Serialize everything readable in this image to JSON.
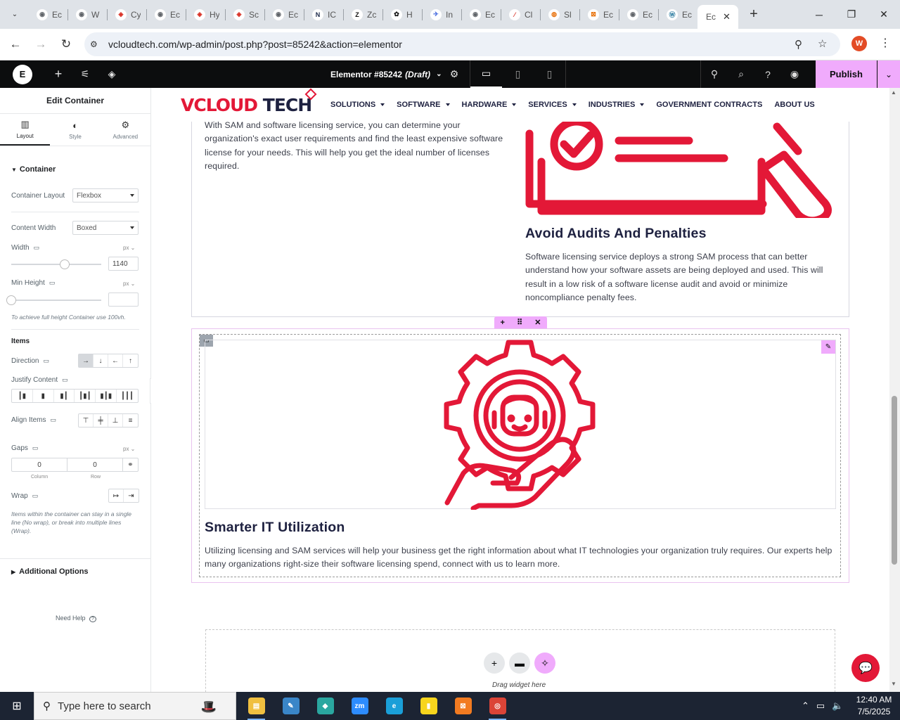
{
  "browser": {
    "tabs": [
      {
        "title": "Ec",
        "icon": "globe-icon",
        "color": "#5f6368",
        "glyph": "◉"
      },
      {
        "title": "W",
        "icon": "globe-icon",
        "color": "#5f6368",
        "glyph": "◉"
      },
      {
        "title": "Cy",
        "icon": "diamond-icon",
        "color": "#d93025",
        "glyph": "◈"
      },
      {
        "title": "Ec",
        "icon": "globe-icon",
        "color": "#5f6368",
        "glyph": "◉"
      },
      {
        "title": "Hy",
        "icon": "diamond-icon",
        "color": "#d93025",
        "glyph": "◈"
      },
      {
        "title": "Sc",
        "icon": "diamond-icon",
        "color": "#d93025",
        "glyph": "◈"
      },
      {
        "title": "Ec",
        "icon": "globe-icon",
        "color": "#5f6368",
        "glyph": "◉"
      },
      {
        "title": "IC",
        "icon": "ic-icon",
        "color": "#1b2a4a",
        "glyph": "N"
      },
      {
        "title": "Zc",
        "icon": "zapier-icon",
        "color": "#111111",
        "glyph": "Z"
      },
      {
        "title": "H",
        "icon": "openai-icon",
        "color": "#111111",
        "glyph": "✿"
      },
      {
        "title": "In",
        "icon": "bird-icon",
        "color": "#4a6ee0",
        "glyph": "✈"
      },
      {
        "title": "Ec",
        "icon": "globe-icon",
        "color": "#5f6368",
        "glyph": "◉"
      },
      {
        "title": "Cl",
        "icon": "claude-icon",
        "color": "#d93025",
        "glyph": "⁄"
      },
      {
        "title": "Sl",
        "icon": "colorwheel-icon",
        "color": "#e8710a",
        "glyph": "◍"
      },
      {
        "title": "Ec",
        "icon": "xampp-icon",
        "color": "#e8710a",
        "glyph": "⊠"
      },
      {
        "title": "Ec",
        "icon": "globe-icon",
        "color": "#5f6368",
        "glyph": "◉"
      },
      {
        "title": "Ec",
        "icon": "wordpress-icon",
        "color": "#21759b",
        "glyph": "Ⓦ"
      }
    ],
    "active_tab": {
      "title": "Ec",
      "close": "✕"
    },
    "new_tab": "+",
    "url": "vcloudtech.com/wp-admin/post.php?post=85242&action=elementor",
    "profile_initial": "W"
  },
  "elementor": {
    "doc_title": "Elementor #85242",
    "doc_status": "(Draft)",
    "publish_label": "Publish",
    "panel": {
      "title": "Edit Container",
      "tabs": [
        {
          "label": "Layout",
          "icon": "layout-icon"
        },
        {
          "label": "Style",
          "icon": "style-icon"
        },
        {
          "label": "Advanced",
          "icon": "gear-icon"
        }
      ],
      "section": "Container",
      "container_layout_label": "Container Layout",
      "container_layout_value": "Flexbox",
      "content_width_label": "Content Width",
      "content_width_value": "Boxed",
      "width_label": "Width",
      "width_unit": "px",
      "width_value": "1140",
      "width_slider_fraction": 0.59,
      "min_height_label": "Min Height",
      "min_height_unit": "px",
      "min_height_value": "",
      "min_height_hint": "To achieve full height Container use 100vh.",
      "items_label": "Items",
      "direction_label": "Direction",
      "justify_label": "Justify Content",
      "align_label": "Align Items",
      "gaps_label": "Gaps",
      "gaps_unit": "px",
      "gap_column": "0",
      "gap_row": "0",
      "gap_column_label": "Column",
      "gap_row_label": "Row",
      "wrap_label": "Wrap",
      "wrap_hint": "Items within the container can stay in a single line (No wrap), or break into multiple lines (Wrap).",
      "additional_options": "Additional Options",
      "need_help": "Need Help"
    }
  },
  "site": {
    "brand_left": "VCLOUD",
    "brand_right": "TECH",
    "menu": [
      {
        "label": "SOLUTIONS",
        "caret": true
      },
      {
        "label": "SOFTWARE",
        "caret": true
      },
      {
        "label": "HARDWARE",
        "caret": true
      },
      {
        "label": "SERVICES",
        "caret": true
      },
      {
        "label": "INDUSTRIES",
        "caret": true
      },
      {
        "label": "GOVERNMENT CONTRACTS",
        "caret": false
      },
      {
        "label": "ABOUT US",
        "caret": false
      }
    ],
    "para_top": "With SAM and software licensing service, you can determine your organization's exact user requirements and find the least expensive software license for your needs. This will help you get the ideal number of licenses required.",
    "audit_title": "Avoid Audits And Penalties",
    "audit_text": "Software licensing service deploys a strong SAM process that can better understand how your software assets are being deployed and used. This will result in a low risk of a software license audit and avoid or minimize noncompliance penalty fees.",
    "it_title": "Smarter IT Utilization",
    "it_text": "Utilizing licensing and SAM services will help your business get the right information about what IT technologies your organization truly requires. Our experts help many organizations right-size their software licensing spend, connect with us to learn more.",
    "drag_text": "Drag widget here",
    "accent": "#e31837"
  },
  "taskbar": {
    "search_placeholder": "Type here to search",
    "time": "12:40 AM",
    "date": "7/5/2025",
    "apps": [
      {
        "name": "file-explorer",
        "color": "#f0c040",
        "glyph": "▤"
      },
      {
        "name": "paint-tool",
        "color": "#3a86c8",
        "glyph": "✎"
      },
      {
        "name": "vpn-app",
        "color": "#2aa7a0",
        "glyph": "◆"
      },
      {
        "name": "zoom-app",
        "color": "#2d8cff",
        "glyph": "zm"
      },
      {
        "name": "edge-browser",
        "color": "#1a9fd8",
        "glyph": "e"
      },
      {
        "name": "sticky-notes",
        "color": "#f7d51d",
        "glyph": "▮"
      },
      {
        "name": "xampp-app",
        "color": "#f27b21",
        "glyph": "⊠"
      },
      {
        "name": "chrome-browser",
        "color": "#db4437",
        "glyph": "◎"
      }
    ]
  }
}
